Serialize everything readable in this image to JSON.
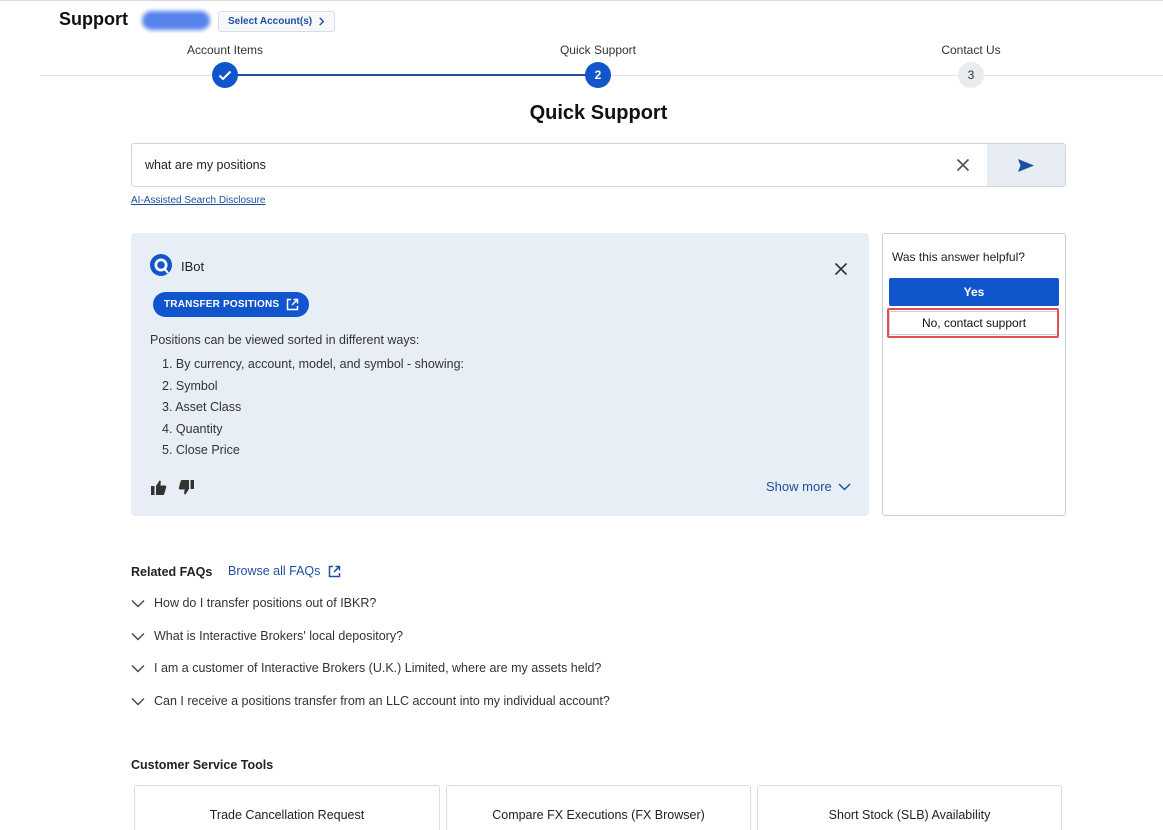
{
  "header": {
    "title": "Support",
    "select_account_label": "Select Account(s)"
  },
  "stepper": {
    "steps": [
      {
        "label": "Account Items",
        "number": "",
        "state": "done"
      },
      {
        "label": "Quick Support",
        "number": "2",
        "state": "active"
      },
      {
        "label": "Contact Us",
        "number": "3",
        "state": "future"
      }
    ]
  },
  "page_title": "Quick Support",
  "search": {
    "value": "what are my positions",
    "disclosure": "AI-Assisted Search Disclosure"
  },
  "answer": {
    "bot_name": "IBot",
    "action_button": "TRANSFER POSITIONS",
    "intro": "Positions can be viewed sorted in different ways:",
    "items": [
      "1. By currency, account, model, and symbol - showing:",
      "2. Symbol",
      "3. Asset Class",
      "4. Quantity",
      "5. Close Price"
    ],
    "show_more": "Show more"
  },
  "feedback": {
    "question": "Was this answer helpful?",
    "yes": "Yes",
    "no": "No, contact support"
  },
  "faqs": {
    "heading": "Related FAQs",
    "browse_label": "Browse all FAQs",
    "items": [
      "How do I transfer positions out of IBKR?",
      "What is Interactive Brokers' local depository?",
      "I am a customer of Interactive Brokers (U.K.) Limited, where are my assets held?",
      "Can I receive a positions transfer from an LLC account into my individual account?"
    ]
  },
  "tools": {
    "heading": "Customer Service Tools",
    "items": [
      "Trade Cancellation Request",
      "Compare FX Executions (FX Browser)",
      "Short Stock (SLB) Availability"
    ]
  },
  "colors": {
    "primary": "#1155cc",
    "link": "#1d4fa3",
    "answer_bg": "#e8eef6",
    "highlight": "#e05050"
  }
}
